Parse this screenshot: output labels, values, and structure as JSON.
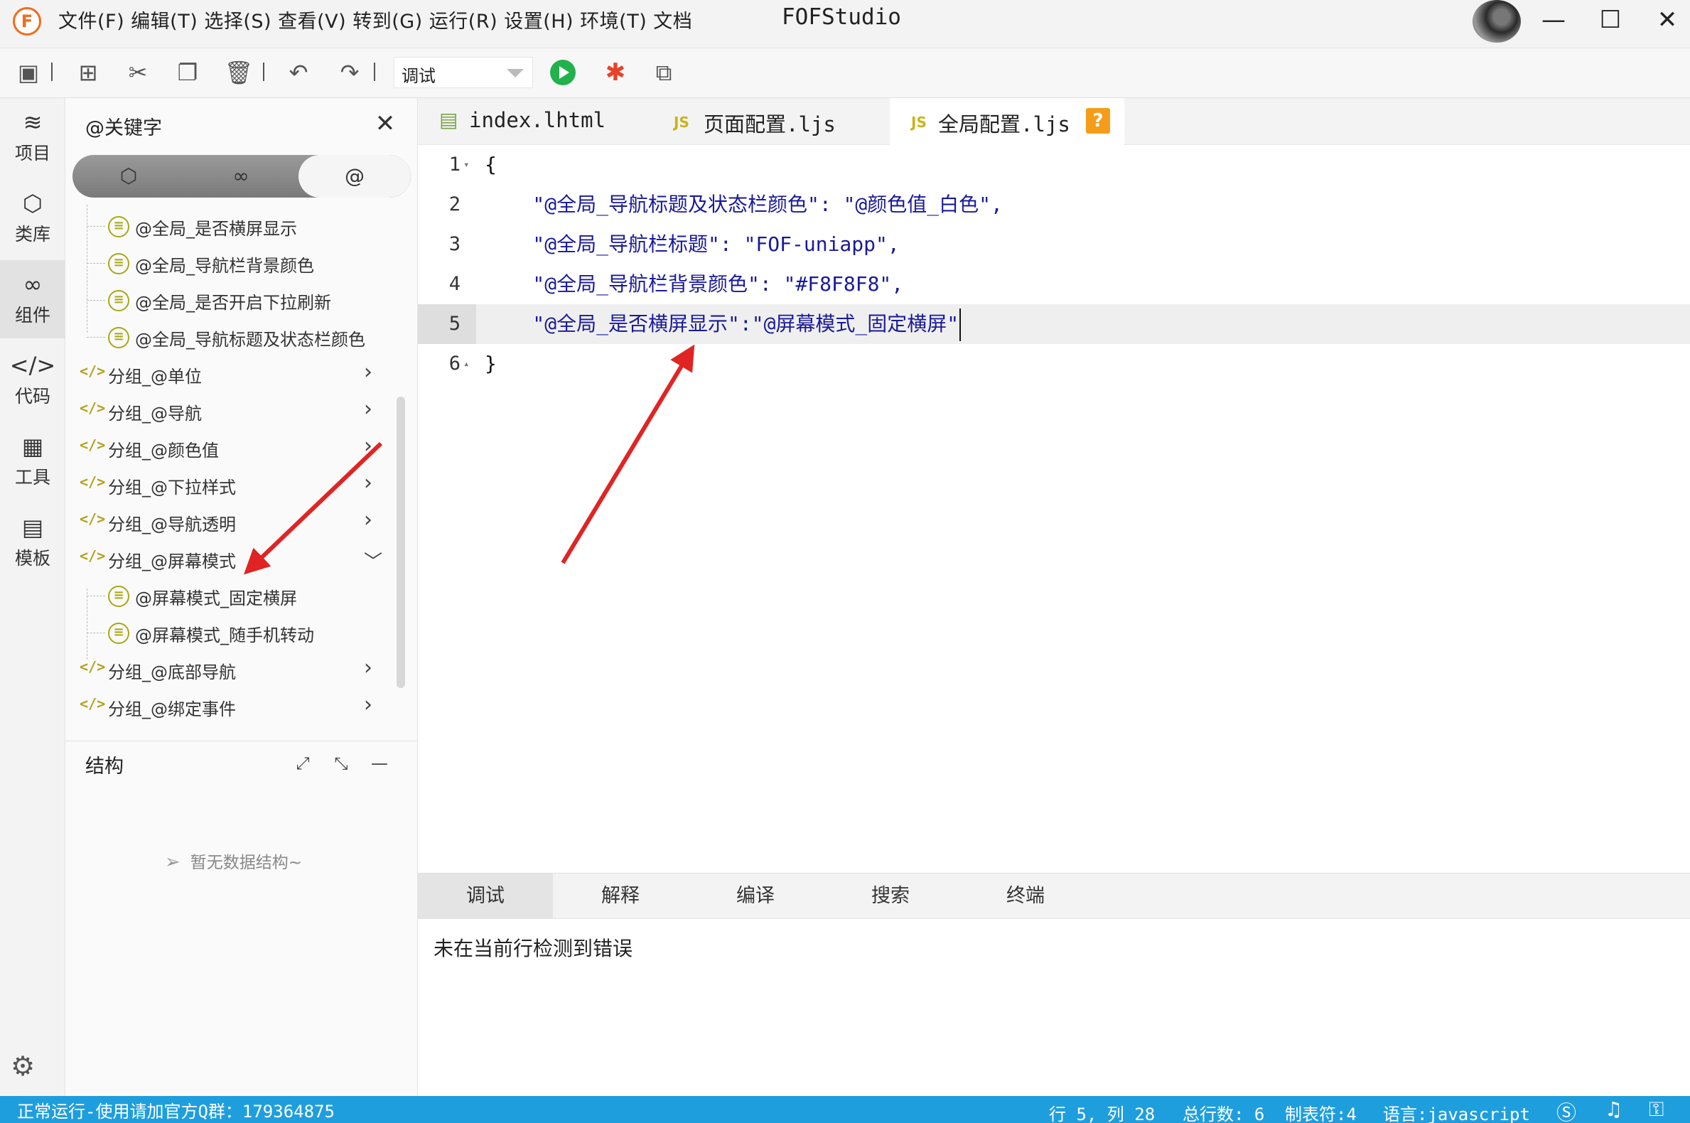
{
  "titlebar": {
    "menu": "文件(F) 编辑(T) 选择(S) 查看(V) 转到(G) 运行(R) 设置(H) 环境(T) 文档",
    "app_title": "FOFStudio",
    "logo_letter": "F"
  },
  "toolbar": {
    "run_target": "调试",
    "icons": [
      "save-icon",
      "new-file-icon",
      "cut-icon",
      "copy-icon",
      "delete-icon",
      "undo-icon",
      "redo-icon",
      "run-icon",
      "debug-icon",
      "preview-icon"
    ],
    "colors": {
      "run": "#22b14c",
      "debug": "#e8412a"
    }
  },
  "activitybar": {
    "items": [
      {
        "label": "项目",
        "icon": "layers-icon"
      },
      {
        "label": "类库",
        "icon": "cube-icon"
      },
      {
        "label": "组件",
        "icon": "link-icon"
      },
      {
        "label": "代码",
        "icon": "code-icon"
      },
      {
        "label": "工具",
        "icon": "grid-icon"
      },
      {
        "label": "模板",
        "icon": "template-icon"
      }
    ],
    "active_index": 2
  },
  "keyword_panel": {
    "title": "@关键字",
    "segments": [
      "cube",
      "link",
      "@"
    ],
    "tree": [
      {
        "type": "child",
        "label": "@全局_是否横屏显示"
      },
      {
        "type": "child",
        "label": "@全局_导航栏背景颜色"
      },
      {
        "type": "child",
        "label": "@全局_是否开启下拉刷新"
      },
      {
        "type": "child",
        "label": "@全局_导航标题及状态栏颜色"
      },
      {
        "type": "group",
        "label": "分组_@单位",
        "expanded": false
      },
      {
        "type": "group",
        "label": "分组_@导航",
        "expanded": false
      },
      {
        "type": "group",
        "label": "分组_@颜色值",
        "expanded": false
      },
      {
        "type": "group",
        "label": "分组_@下拉样式",
        "expanded": false
      },
      {
        "type": "group",
        "label": "分组_@导航透明",
        "expanded": false
      },
      {
        "type": "group",
        "label": "分组_@屏幕模式",
        "expanded": true
      },
      {
        "type": "child",
        "label": "@屏幕模式_固定横屏"
      },
      {
        "type": "child",
        "label": "@屏幕模式_随手机转动"
      },
      {
        "type": "group",
        "label": "分组_@底部导航",
        "expanded": false
      },
      {
        "type": "group",
        "label": "分组_@绑定事件",
        "expanded": false
      }
    ],
    "structure_title": "结构",
    "structure_empty": "暂无数据结构~"
  },
  "editor": {
    "tabs": [
      {
        "label": "index.lhtml",
        "icon": "html-file-icon",
        "active": false
      },
      {
        "label": "页面配置.ljs",
        "icon": "js-file-icon",
        "active": false
      },
      {
        "label": "全局配置.ljs",
        "icon": "js-file-icon",
        "active": true,
        "badge": "?"
      }
    ],
    "lines": [
      {
        "num": "1",
        "text": "{",
        "fold": "▾"
      },
      {
        "num": "2",
        "text": "    \"@全局_导航标题及状态栏颜色\": \"@颜色值_白色\",",
        "fold": ""
      },
      {
        "num": "3",
        "text": "    \"@全局_导航栏标题\": \"FOF-uniapp\",",
        "fold": ""
      },
      {
        "num": "4",
        "text": "    \"@全局_导航栏背景颜色\": \"#F8F8F8\",",
        "fold": ""
      },
      {
        "num": "5",
        "text": "    \"@全局_是否横屏显示\":\"@屏幕模式_固定横屏\"",
        "fold": ""
      },
      {
        "num": "6",
        "text": "}",
        "fold": "▴"
      }
    ],
    "current_line": 5
  },
  "output_panel": {
    "tabs": [
      "调试",
      "解释",
      "编译",
      "搜索",
      "终端"
    ],
    "active_tab": 0,
    "message": "未在当前行检测到错误"
  },
  "statusbar": {
    "left": "正常运行-使用请加官方Q群：179364875",
    "position": "行 5, 列 28",
    "total_lines": "总行数: 6",
    "tab_size": "制表符:4",
    "language": "语言:javascript",
    "background": "#1f9ede"
  }
}
